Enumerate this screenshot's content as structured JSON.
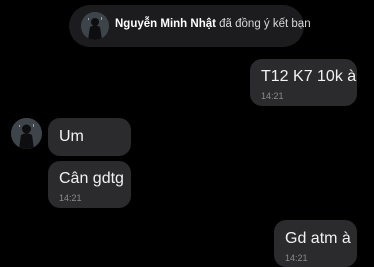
{
  "friend_notice": {
    "name": "Nguyễn Minh Nhật",
    "action": "đã đồng ý kết bạn"
  },
  "messages": [
    {
      "side": "right",
      "text": "T12 K7 10k à",
      "time": "14:21"
    },
    {
      "side": "left",
      "text": "Um"
    },
    {
      "side": "left",
      "text": "Cân gdtg",
      "time": "14:21"
    },
    {
      "side": "right",
      "text": "Gd atm à",
      "time": "14:21"
    }
  ],
  "icons": {
    "notice_avatar": "person-silhouette-avatar",
    "sender_avatar": "person-silhouette-avatar"
  },
  "colors": {
    "background": "#000000",
    "bubble": "#2b2b2e",
    "notice": "#1c1c1e"
  }
}
